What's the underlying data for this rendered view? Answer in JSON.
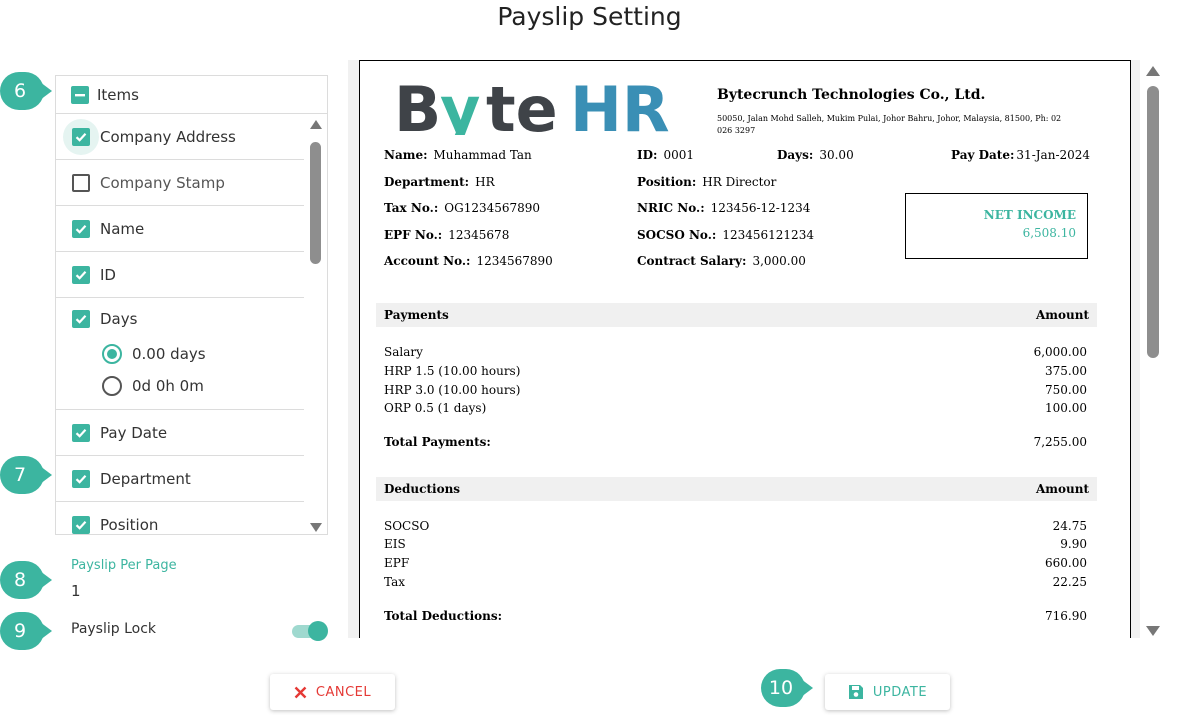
{
  "page": {
    "title": "Payslip Setting"
  },
  "callouts": {
    "c6": "6",
    "c7": "7",
    "c8": "8",
    "c9": "9",
    "c10": "10"
  },
  "items_panel": {
    "header_label": "Items",
    "items": [
      {
        "label": "Company Address",
        "checked": true
      },
      {
        "label": "Company Stamp",
        "checked": false
      },
      {
        "label": "Name",
        "checked": true
      },
      {
        "label": "ID",
        "checked": true
      },
      {
        "label": "Days",
        "checked": true
      },
      {
        "label": "Pay Date",
        "checked": true
      },
      {
        "label": "Department",
        "checked": true
      },
      {
        "label": "Position",
        "checked": true
      }
    ],
    "days_options": [
      {
        "label": "0.00 days",
        "selected": true
      },
      {
        "label": "0d 0h 0m",
        "selected": false
      }
    ]
  },
  "settings": {
    "payslip_per_page_label": "Payslip Per Page",
    "payslip_per_page_value": "1",
    "payslip_lock_label": "Payslip Lock",
    "payslip_lock_on": true
  },
  "payslip": {
    "logo": {
      "text_b": "B",
      "text_y": "y",
      "text_te": "te",
      "text_hr": "HR"
    },
    "company_name": "Bytecrunch Technologies Co., Ltd.",
    "company_address": "50050, Jalan Mohd Salleh, Mukim Pulai, Johor Bahru, Johor, Malaysia, 81500, Ph: 02 026 3297",
    "fields": {
      "name_label": "Name:",
      "name_value": "Muhammad Tan",
      "id_label": "ID:",
      "id_value": "0001",
      "days_label": "Days:",
      "days_value": "30.00",
      "paydate_label": "Pay Date:",
      "paydate_value": "31-Jan-2024",
      "department_label": "Department:",
      "department_value": "HR",
      "position_label": "Position:",
      "position_value": "HR Director",
      "tax_label": "Tax No.:",
      "tax_value": "OG1234567890",
      "nric_label": "NRIC No.:",
      "nric_value": "123456-12-1234",
      "epf_label": "EPF No.:",
      "epf_value": "12345678",
      "socso_label": "SOCSO No.:",
      "socso_value": "123456121234",
      "account_label": "Account No.:",
      "account_value": "1234567890",
      "contract_label": "Contract Salary:",
      "contract_value": "3,000.00"
    },
    "net_income": {
      "label": "NET INCOME",
      "value": "6,508.10"
    },
    "payments": {
      "header": "Payments",
      "amount_header": "Amount",
      "rows": [
        {
          "label": "Salary",
          "amount": "6,000.00"
        },
        {
          "label": "HRP 1.5 (10.00 hours)",
          "amount": "375.00"
        },
        {
          "label": "HRP 3.0 (10.00 hours)",
          "amount": "750.00"
        },
        {
          "label": "ORP 0.5 (1 days)",
          "amount": "100.00"
        }
      ],
      "total_label": "Total Payments:",
      "total_value": "7,255.00"
    },
    "deductions": {
      "header": "Deductions",
      "amount_header": "Amount",
      "rows": [
        {
          "label": "SOCSO",
          "amount": "24.75"
        },
        {
          "label": "EIS",
          "amount": "9.90"
        },
        {
          "label": "EPF",
          "amount": "660.00"
        },
        {
          "label": "Tax",
          "amount": "22.25"
        }
      ],
      "total_label": "Total Deductions:",
      "total_value": "716.90"
    }
  },
  "buttons": {
    "cancel": "CANCEL",
    "update": "UPDATE"
  },
  "colors": {
    "accent": "#3cb5a0",
    "danger": "#e53935",
    "logo_dark": "#3f4348"
  }
}
